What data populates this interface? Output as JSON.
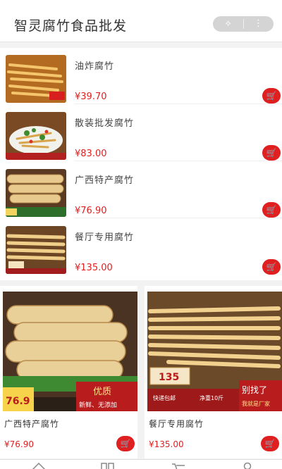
{
  "header": {
    "title": "智灵腐竹食品批发",
    "capsule_left_icon": "share-icon",
    "capsule_right_icon": "more-icon",
    "capsule_left_glyph": "⟡",
    "capsule_right_glyph": "⋮"
  },
  "list": [
    {
      "name": "油炸腐竹",
      "price": "¥39.70"
    },
    {
      "name": "散装批发腐竹",
      "price": "¥83.00"
    },
    {
      "name": "广西特产腐竹",
      "price": "¥76.90"
    },
    {
      "name": "餐厅专用腐竹",
      "price": "¥135.00"
    }
  ],
  "grid": [
    {
      "name": "广西特产腐竹",
      "price": "¥76.90",
      "img_tag": "76.9",
      "banner": "优质",
      "banner_sub": "新鲜、无添加"
    },
    {
      "name": "餐厅专用腐竹",
      "price": "¥135.00",
      "img_tag": "135",
      "banner": "别找了",
      "banner_sub": "我就是厂家",
      "badge1": "快递包邮",
      "badge2": "净重10斤"
    }
  ],
  "cart_glyph": "🛒",
  "tabs": [
    {
      "icon": "home-icon"
    },
    {
      "icon": "category-icon"
    },
    {
      "icon": "cart-icon"
    },
    {
      "icon": "user-icon"
    }
  ],
  "colors": {
    "accent": "#e02020",
    "capsule": "#d4d4d4",
    "price": "#e02020"
  }
}
